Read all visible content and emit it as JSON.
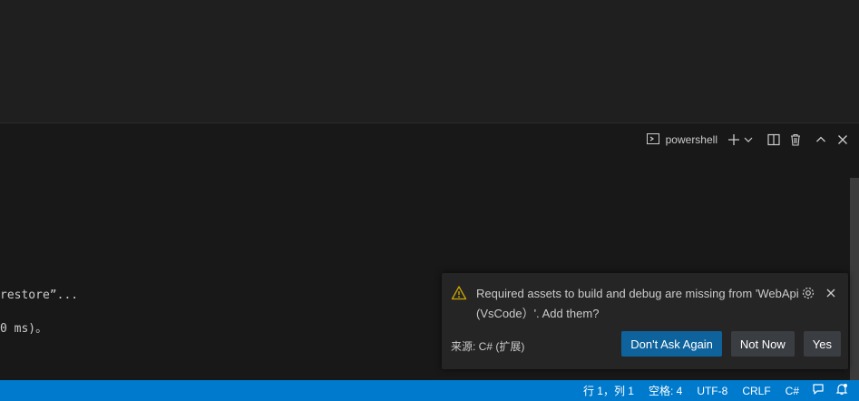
{
  "panel": {
    "terminal_name": "powershell"
  },
  "terminal": {
    "lines": [
      "restore”...",
      "0 ms)。"
    ]
  },
  "notification": {
    "message": "Required assets to build and debug are missing from 'WebApi (VsCode）'. Add them?",
    "source": "来源: C# (扩展)",
    "buttons": {
      "dont_ask": "Don't Ask Again",
      "not_now": "Not Now",
      "yes": "Yes"
    }
  },
  "statusbar": {
    "position": "行 1，列 1",
    "indent": "空格: 4",
    "encoding": "UTF-8",
    "eol": "CRLF",
    "language": "C#"
  },
  "colors": {
    "statusbar_bg": "#007acc",
    "primary_button": "#0e639c",
    "warning": "#cca700"
  },
  "icons": [
    "terminal-icon",
    "plus-icon",
    "chevron-down-icon",
    "split-icon",
    "trash-icon",
    "chevron-up-icon",
    "close-icon",
    "warning-icon",
    "gear-icon",
    "feedback-icon",
    "bell-icon"
  ]
}
